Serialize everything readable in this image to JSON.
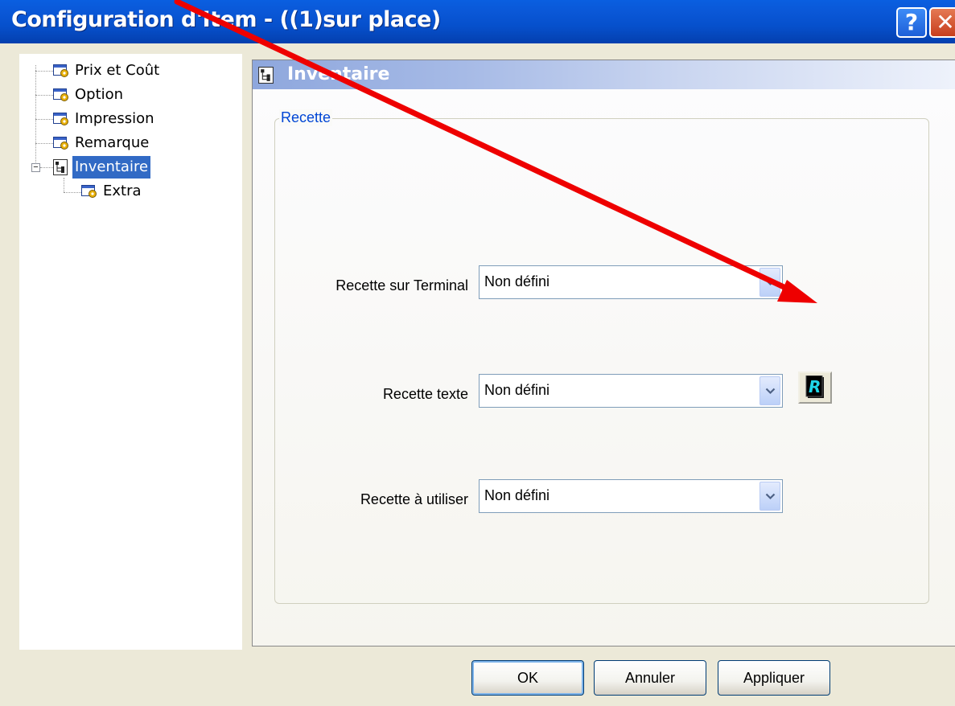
{
  "window": {
    "title": "Configuration d'Item - ((1)sur place)",
    "help_label": "?",
    "close_label": "✕"
  },
  "tree": {
    "items": [
      {
        "label": "Prix et Coût",
        "icon": "settings-gear-icon"
      },
      {
        "label": "Option",
        "icon": "settings-gear-icon"
      },
      {
        "label": "Impression",
        "icon": "settings-gear-icon"
      },
      {
        "label": "Remarque",
        "icon": "settings-gear-icon"
      },
      {
        "label": "Inventaire",
        "icon": "inventory-tree-icon",
        "selected": true,
        "expanded": true
      },
      {
        "label": "Extra",
        "icon": "settings-gear-icon"
      }
    ]
  },
  "panel": {
    "title": "Inventaire",
    "group_title": "Recette",
    "fields": [
      {
        "label": "Recette sur Terminal",
        "value": "Non défini"
      },
      {
        "label": "Recette texte",
        "value": "Non défini"
      },
      {
        "label": "Recette à utiliser",
        "value": "Non défini"
      }
    ],
    "recipe_button_glyph": "R"
  },
  "buttons": {
    "ok": "OK",
    "cancel": "Annuler",
    "apply": "Appliquer"
  },
  "colors": {
    "titlebar": "#0a58d8",
    "selection": "#316ac5",
    "annotation_arrow": "#ee0000",
    "group_title": "#0046d5"
  }
}
